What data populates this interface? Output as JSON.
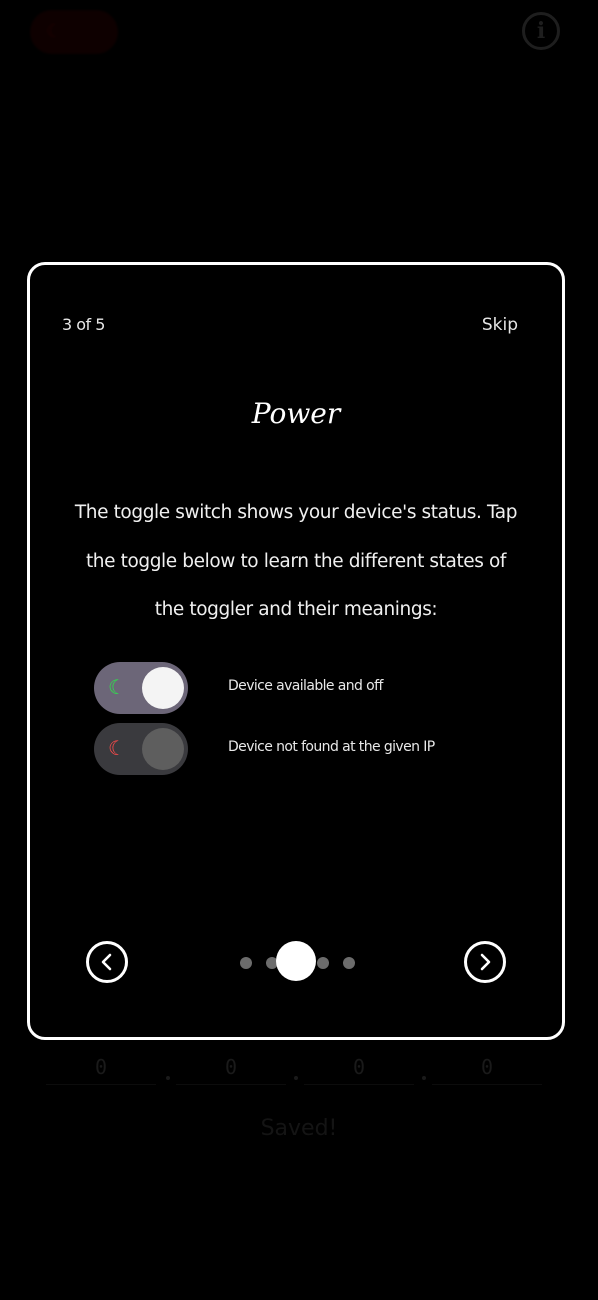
{
  "background": {
    "power_toggle_icon": "moon-icon",
    "info_icon": "info-circle-icon",
    "ip_fields": [
      "0",
      "0",
      "0",
      "0"
    ],
    "saved_text": "Saved!"
  },
  "modal": {
    "step_label": "3 of 5",
    "skip_label": "Skip",
    "title": "Power",
    "description": "The toggle switch shows your device's status. Tap the toggle below to learn the different states of the toggler and their meanings:",
    "states": [
      {
        "label": "Device available and off",
        "icon": "moon-icon",
        "icon_color": "#2ee24b",
        "on": true
      },
      {
        "label": "Device not found at the given IP",
        "icon": "moon-icon",
        "icon_color": "#ff4b4b",
        "on": false
      }
    ],
    "pager": {
      "total": 5,
      "current": 3
    },
    "prev_icon": "chevron-left-icon",
    "next_icon": "chevron-right-icon"
  }
}
